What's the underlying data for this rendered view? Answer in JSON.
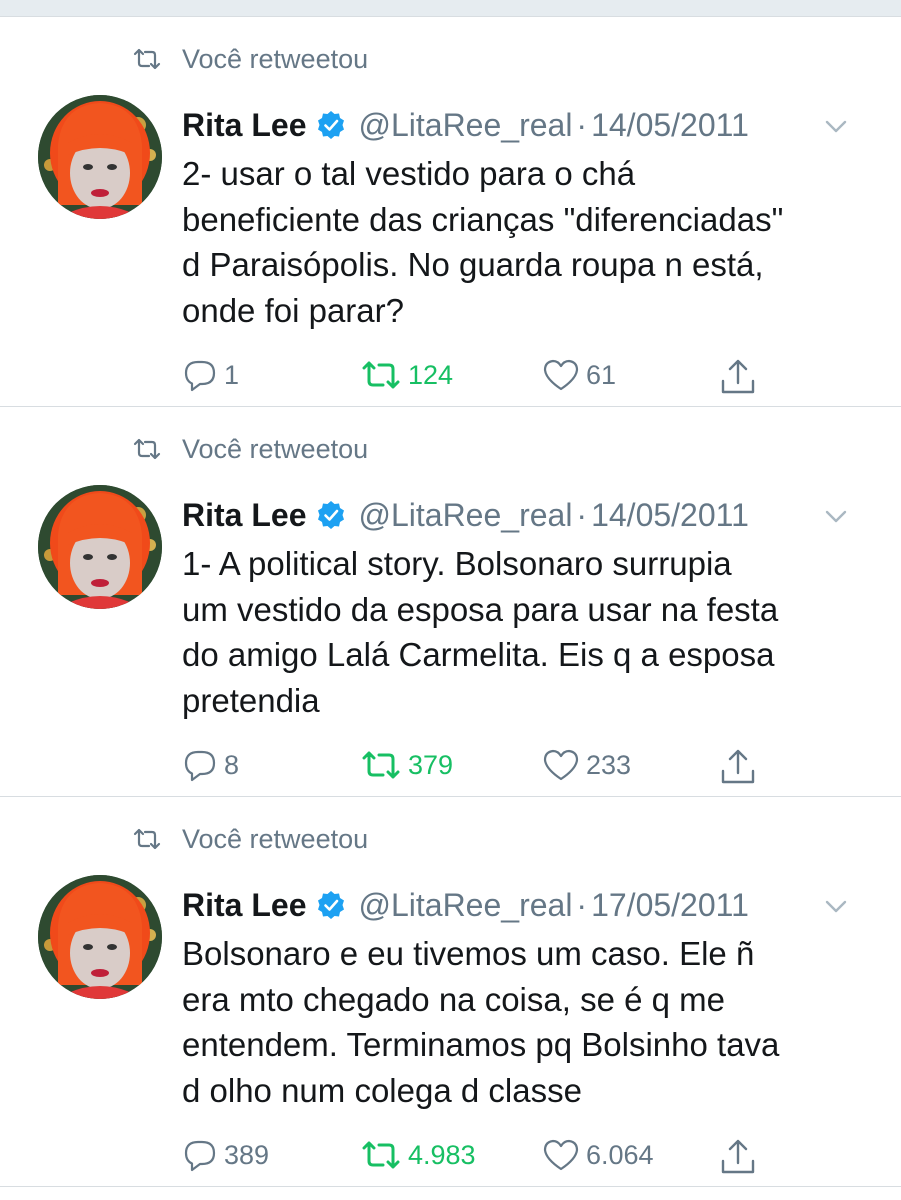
{
  "retweet_label": "Você retweetou",
  "colors": {
    "retweeted": "#17bf63",
    "muted": "#657786",
    "verified": "#1da1f2",
    "text": "#14171a"
  },
  "icons": {
    "retweet": "retweet-icon",
    "verified": "verified-badge-icon",
    "menu": "chevron-down-icon",
    "reply": "reply-icon",
    "like": "heart-icon",
    "share": "share-icon"
  },
  "tweets": [
    {
      "name": "Rita Lee",
      "handle": "@LitaRee_real",
      "separator": "·",
      "date": "14/05/2011",
      "lines": [
        "2- usar o tal vestido para o chá",
        "beneficiente das crianças \"diferenciadas\"",
        "d Paraisópolis. No guarda roupa n está,",
        "onde foi parar?"
      ],
      "replies": "1",
      "retweets": "124",
      "likes": "61"
    },
    {
      "name": "Rita Lee",
      "handle": "@LitaRee_real",
      "separator": "·",
      "date": "14/05/2011",
      "lines": [
        "1- A political story. Bolsonaro surrupia",
        "um vestido da esposa para usar na festa",
        "do amigo Lalá Carmelita. Eis q a esposa",
        "pretendia"
      ],
      "replies": "8",
      "retweets": "379",
      "likes": "233"
    },
    {
      "name": "Rita Lee",
      "handle": "@LitaRee_real",
      "separator": "·",
      "date": "17/05/2011",
      "lines": [
        "Bolsonaro e eu tivemos um caso. Ele ñ",
        "era mto chegado na coisa, se é q me",
        "entendem. Terminamos pq Bolsinho tava",
        "d olho num colega d classe"
      ],
      "replies": "389",
      "retweets": "4.983",
      "likes": "6.064"
    }
  ]
}
